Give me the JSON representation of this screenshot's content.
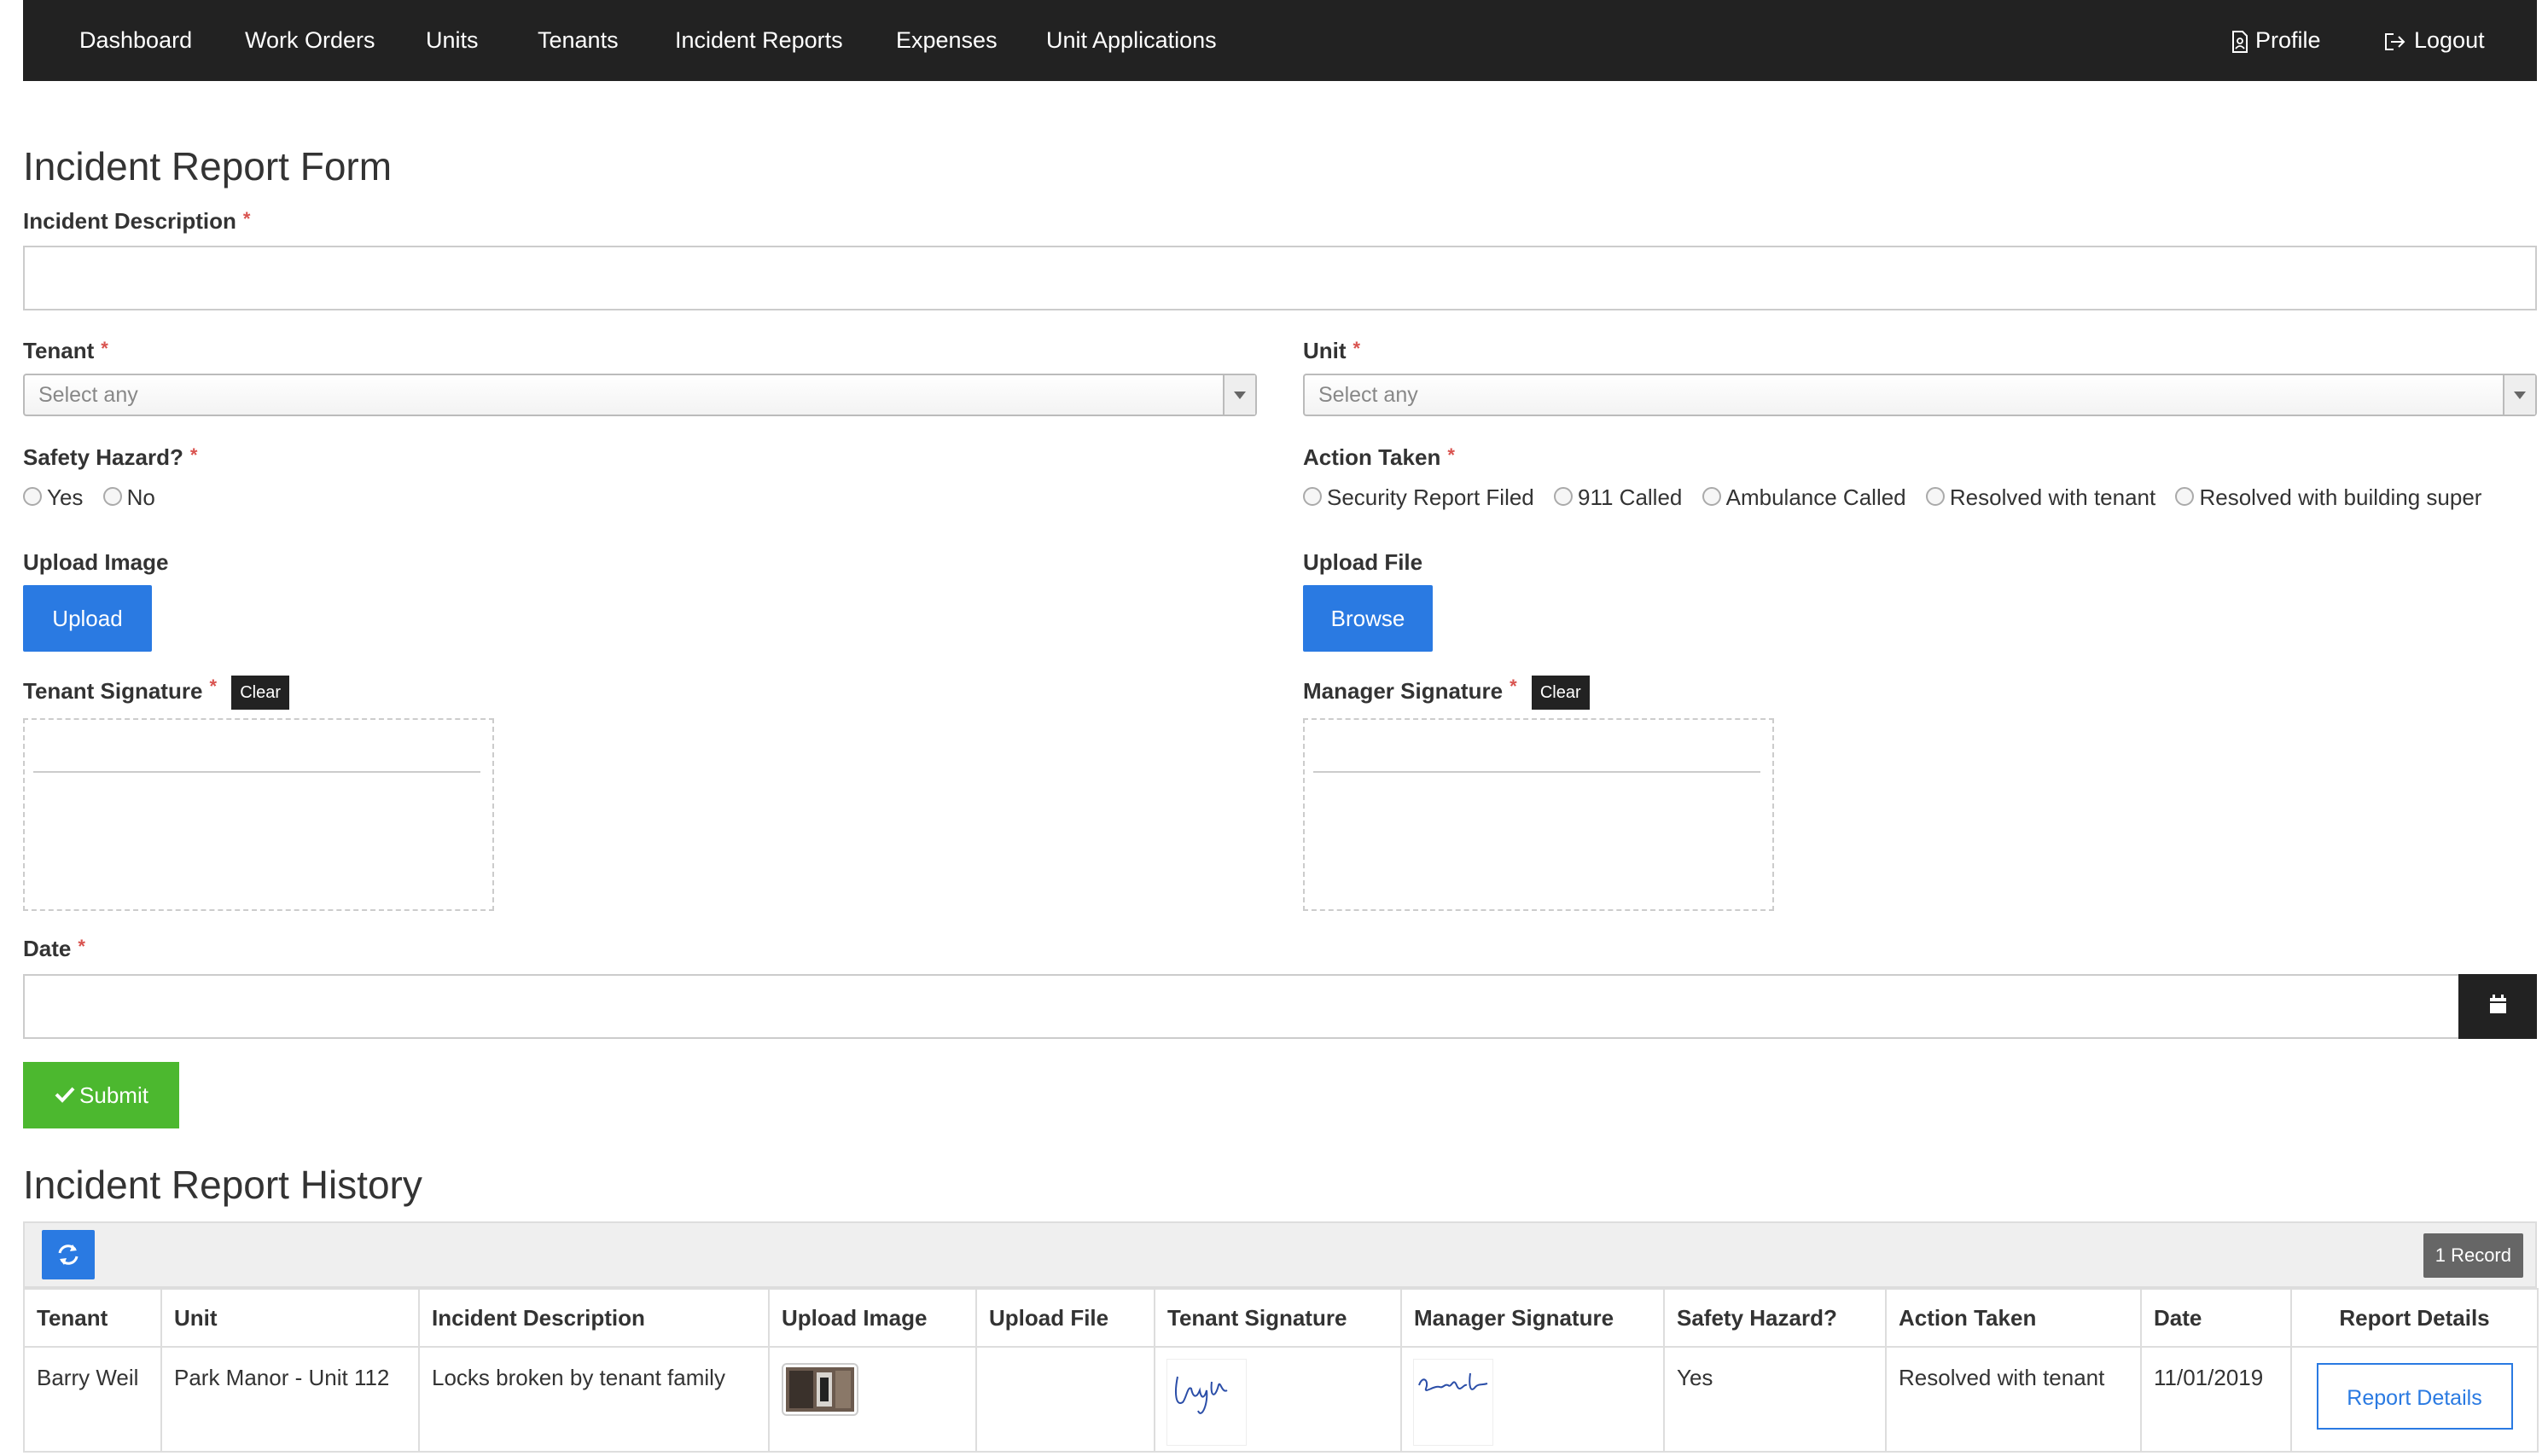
{
  "nav": {
    "items": [
      "Dashboard",
      "Work Orders",
      "Units",
      "Tenants",
      "Incident Reports",
      "Expenses",
      "Unit Applications"
    ],
    "profile": "Profile",
    "logout": "Logout"
  },
  "form": {
    "title": "Incident Report Form",
    "description_label": "Incident Description",
    "description_value": "",
    "required_mark": "*",
    "tenant_label": "Tenant",
    "tenant_placeholder": "Select any",
    "unit_label": "Unit",
    "unit_placeholder": "Select any",
    "safety_label": "Safety Hazard?",
    "safety_options": [
      "Yes",
      "No"
    ],
    "action_label": "Action Taken",
    "action_options": [
      "Security Report Filed",
      "911 Called",
      "Ambulance Called",
      "Resolved with tenant",
      "Resolved with building super"
    ],
    "upload_image_label": "Upload Image",
    "upload_button": "Upload",
    "upload_file_label": "Upload File",
    "browse_button": "Browse",
    "tenant_sig_label": "Tenant Signature",
    "manager_sig_label": "Manager Signature",
    "clear_label": "Clear",
    "date_label": "Date",
    "date_value": "",
    "submit_label": "Submit"
  },
  "history": {
    "title": "Incident Report History",
    "record_count": "1 Record",
    "columns": [
      "Tenant",
      "Unit",
      "Incident Description",
      "Upload Image",
      "Upload File",
      "Tenant Signature",
      "Manager Signature",
      "Safety Hazard?",
      "Action Taken",
      "Date",
      "Report Details"
    ],
    "rows": [
      {
        "tenant": "Barry Weil",
        "unit": "Park Manor - Unit 112",
        "description": "Locks broken by tenant family",
        "upload_file": "",
        "safety": "Yes",
        "action": "Resolved with tenant",
        "date": "11/01/2019",
        "details_button": "Report Details"
      }
    ]
  },
  "colors": {
    "navbar": "#222222",
    "primary": "#2a7ae2",
    "success": "#4cb82f",
    "required": "#d9534f"
  }
}
